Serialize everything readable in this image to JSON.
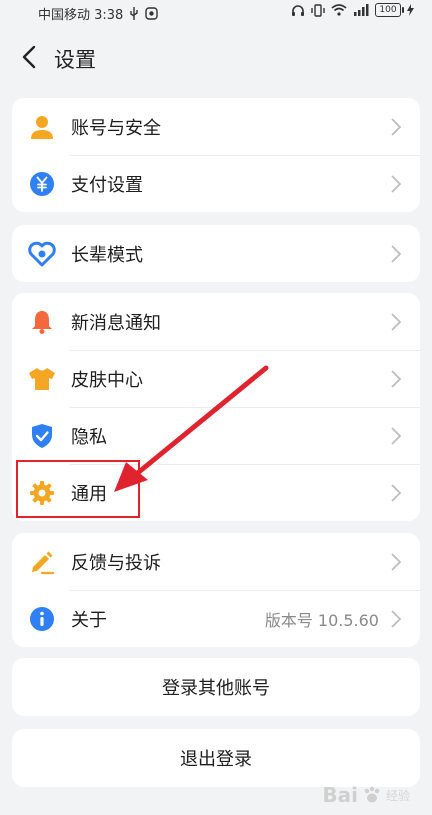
{
  "status_bar": {
    "carrier_time": "中国移动 3:38",
    "battery": "100"
  },
  "header": {
    "title": "设置"
  },
  "groups": [
    {
      "items": [
        {
          "label": "账号与安全",
          "icon": "person-icon",
          "color": "#f5a623"
        },
        {
          "label": "支付设置",
          "icon": "yuan-icon",
          "color": "#2f7ff5"
        }
      ]
    },
    {
      "items": [
        {
          "label": "长辈模式",
          "icon": "heart-icon",
          "color": "#2f7ff5"
        }
      ]
    },
    {
      "items": [
        {
          "label": "新消息通知",
          "icon": "bell-icon",
          "color": "#f5683c"
        },
        {
          "label": "皮肤中心",
          "icon": "shirt-icon",
          "color": "#f5a623"
        },
        {
          "label": "隐私",
          "icon": "shield-icon",
          "color": "#2f7ff5"
        },
        {
          "label": "通用",
          "icon": "gear-icon",
          "color": "#f5a623"
        }
      ]
    },
    {
      "items": [
        {
          "label": "反馈与投诉",
          "icon": "pencil-icon",
          "color": "#f5a623"
        },
        {
          "label": "关于",
          "value": "版本号 10.5.60",
          "icon": "info-icon",
          "color": "#2f7ff5"
        }
      ]
    }
  ],
  "buttons": {
    "switch_account": "登录其他账号",
    "logout": "退出登录"
  },
  "annotation_color": "#e0242f",
  "watermark": {
    "brand": "Bai",
    "suffix": "经验"
  }
}
